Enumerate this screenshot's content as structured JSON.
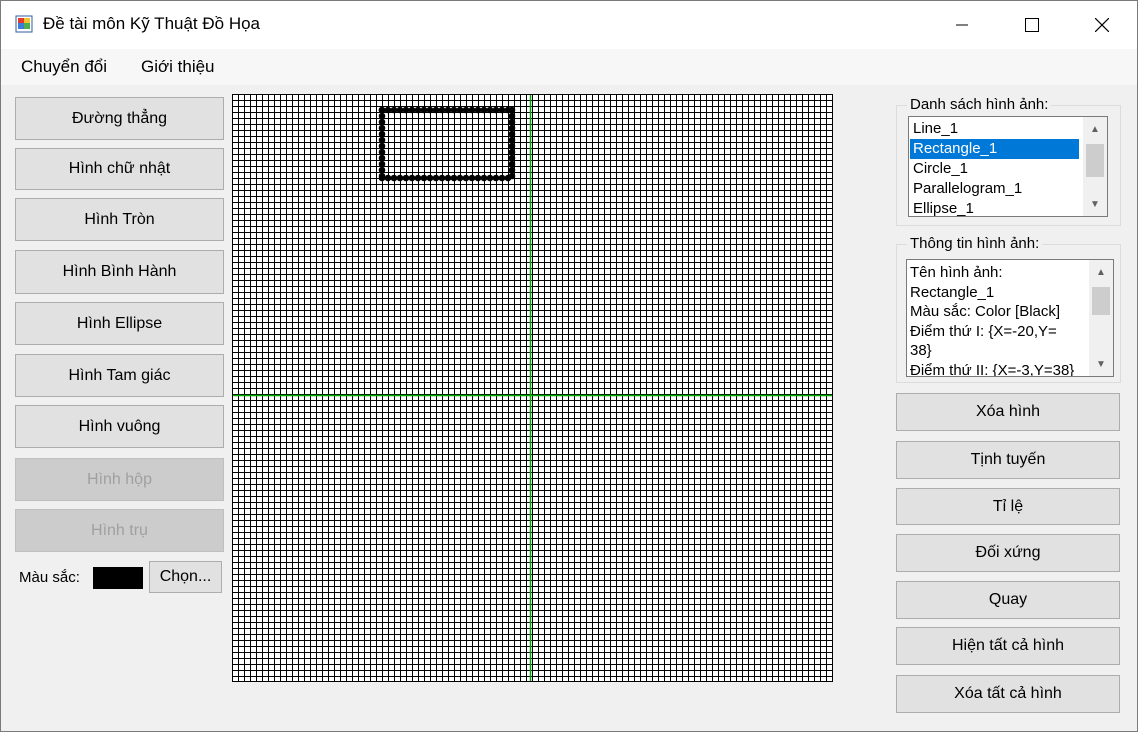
{
  "window": {
    "title": "Đề tài môn Kỹ Thuật Đồ Họa"
  },
  "menu": {
    "items": [
      "Chuyển đổi",
      "Giới thiệu"
    ]
  },
  "left_panel": {
    "shape_buttons": [
      {
        "label": "Đường thẳng",
        "enabled": true
      },
      {
        "label": "Hình chữ nhật",
        "enabled": true
      },
      {
        "label": "Hình Tròn",
        "enabled": true
      },
      {
        "label": "Hình Bình Hành",
        "enabled": true
      },
      {
        "label": "Hình Ellipse",
        "enabled": true
      },
      {
        "label": "Hình Tam giác",
        "enabled": true
      },
      {
        "label": "Hình vuông",
        "enabled": true
      },
      {
        "label": "Hình hộp",
        "enabled": false
      },
      {
        "label": "Hình trụ",
        "enabled": false
      }
    ],
    "color_label": "Màu sắc:",
    "color_value": "#000000",
    "choose_label": "Chọn..."
  },
  "canvas": {
    "axis_color": "#00aa00",
    "grid_color": "#000000"
  },
  "shape_list": {
    "title": "Danh sách hình ảnh:",
    "items": [
      "Line_1",
      "Rectangle_1",
      "Circle_1",
      "Parallelogram_1",
      "Ellipse_1"
    ],
    "selected": "Rectangle_1"
  },
  "shape_info": {
    "title": "Thông tin hình ảnh:",
    "lines": [
      "Tên hình ảnh:",
      "Rectangle_1",
      "Màu sắc: Color [Black]",
      "Điểm thứ I: {X=-20,Y=",
      "38}",
      "Điểm thứ II: {X=-3,Y=38}"
    ]
  },
  "right_buttons": [
    "Xóa hình",
    "Tịnh tuyến",
    "Tỉ lệ",
    "Đối xứng",
    "Quay",
    "Hiện tất cả hình",
    "Xóa tất cả hình"
  ]
}
